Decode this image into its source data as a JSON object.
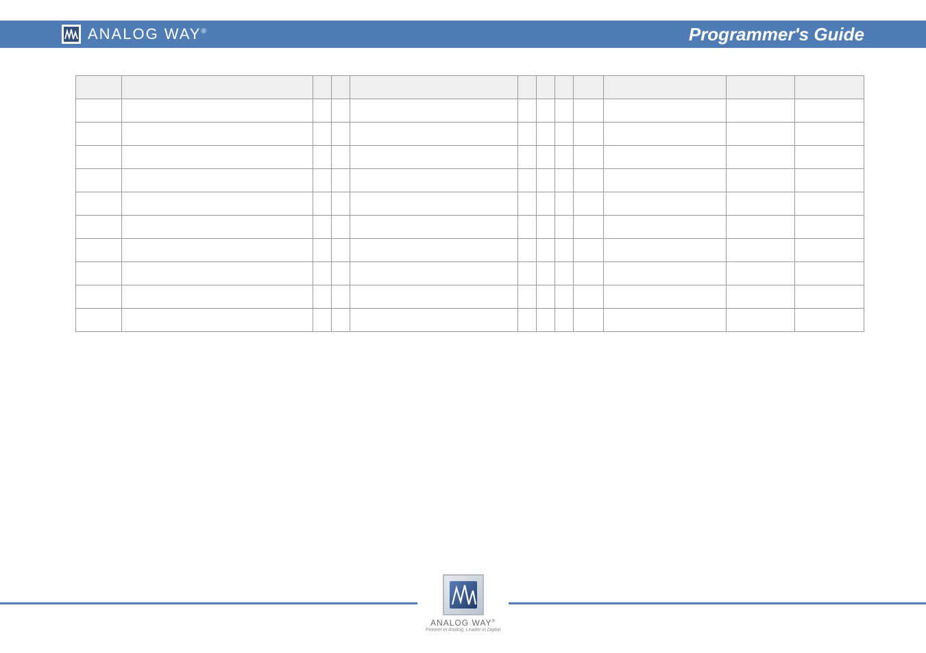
{
  "header": {
    "brand": "ANALOG WAY",
    "title": "Programmer's Guide"
  },
  "table": {
    "headers": [
      "",
      "",
      "",
      "",
      "",
      "",
      "",
      "",
      "",
      "",
      "",
      ""
    ],
    "rows": [
      [
        "",
        "",
        "",
        "",
        "",
        "",
        "",
        "",
        "",
        "",
        "",
        ""
      ],
      [
        "",
        "",
        "",
        "",
        "",
        "",
        "",
        "",
        "",
        "",
        "",
        ""
      ],
      [
        "",
        "",
        "",
        "",
        "",
        "",
        "",
        "",
        "",
        "",
        "",
        ""
      ],
      [
        "",
        "",
        "",
        "",
        "",
        "",
        "",
        "",
        "",
        "",
        "",
        ""
      ],
      [
        "",
        "",
        "",
        "",
        "",
        "",
        "",
        "",
        "",
        "",
        "",
        ""
      ],
      [
        "",
        "",
        "",
        "",
        "",
        "",
        "",
        "",
        "",
        "",
        "",
        ""
      ],
      [
        "",
        "",
        "",
        "",
        "",
        "",
        "",
        "",
        "",
        "",
        "",
        ""
      ],
      [
        "",
        "",
        "",
        "",
        "",
        "",
        "",
        "",
        "",
        "",
        "",
        ""
      ],
      [
        "",
        "",
        "",
        "",
        "",
        "",
        "",
        "",
        "",
        "",
        "",
        ""
      ],
      [
        "",
        "",
        "",
        "",
        "",
        "",
        "",
        "",
        "",
        "",
        "",
        ""
      ]
    ]
  },
  "footer": {
    "brand": "ANALOG WAY",
    "tagline": "Pioneer in Analog, Leader in Digital"
  }
}
